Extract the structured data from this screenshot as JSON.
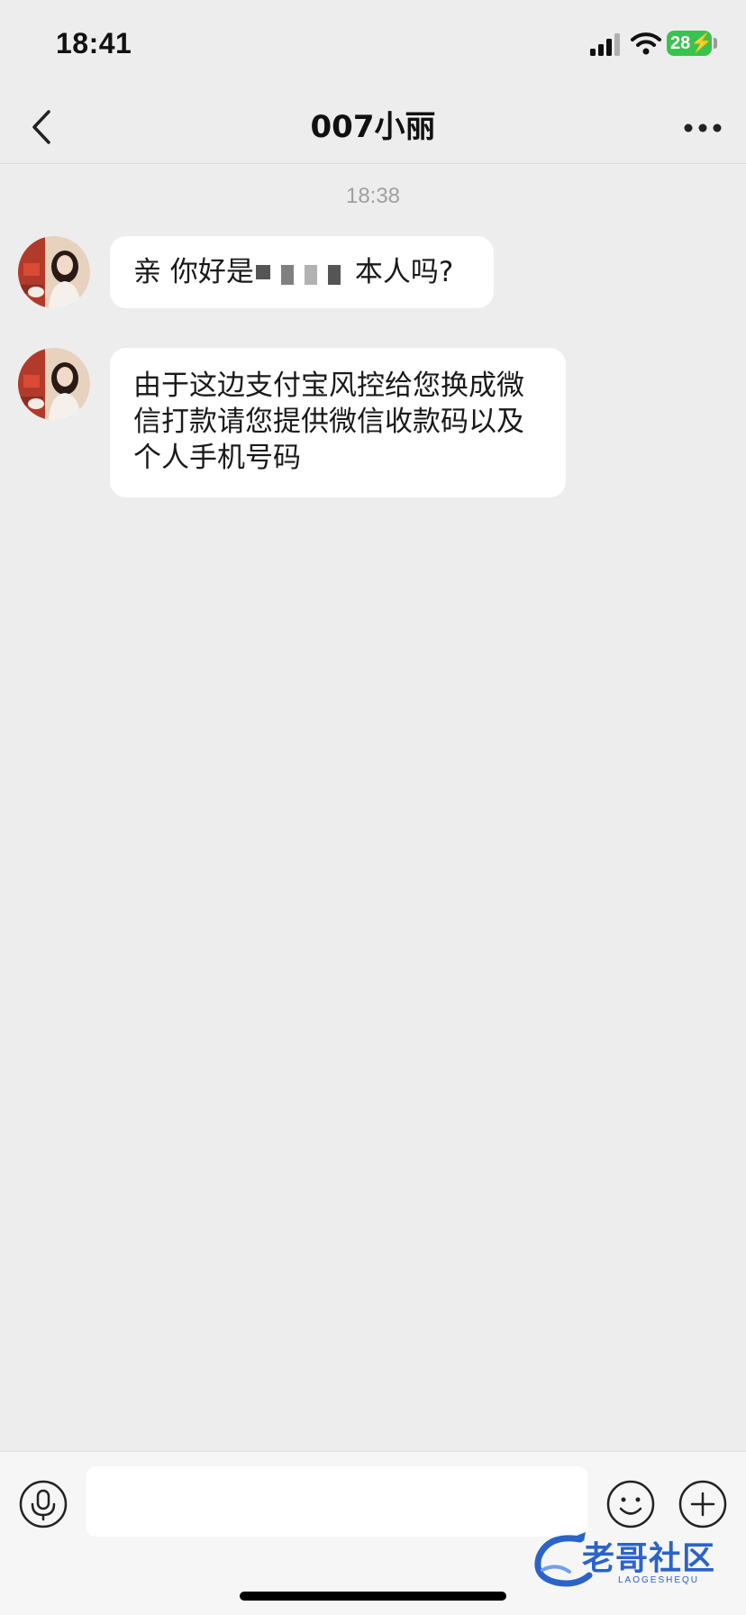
{
  "status_bar": {
    "time": "18:41",
    "battery": "28"
  },
  "nav": {
    "title": "007小丽"
  },
  "chat": {
    "timestamp": "18:38",
    "messages": [
      {
        "text_before": "亲 你好是",
        "text_after": "本人吗?"
      },
      {
        "text": "由于这边支付宝风控给您换成微信打款请您提供微信收款码以及个人手机号码"
      }
    ]
  },
  "input": {
    "placeholder": ""
  },
  "watermark": {
    "title": "老哥社区",
    "subtitle": "LAOGESHEQU"
  },
  "colors": {
    "background": "#ededed",
    "bubble": "#ffffff",
    "battery": "#3ac24e",
    "watermark": "#2b63c9"
  }
}
